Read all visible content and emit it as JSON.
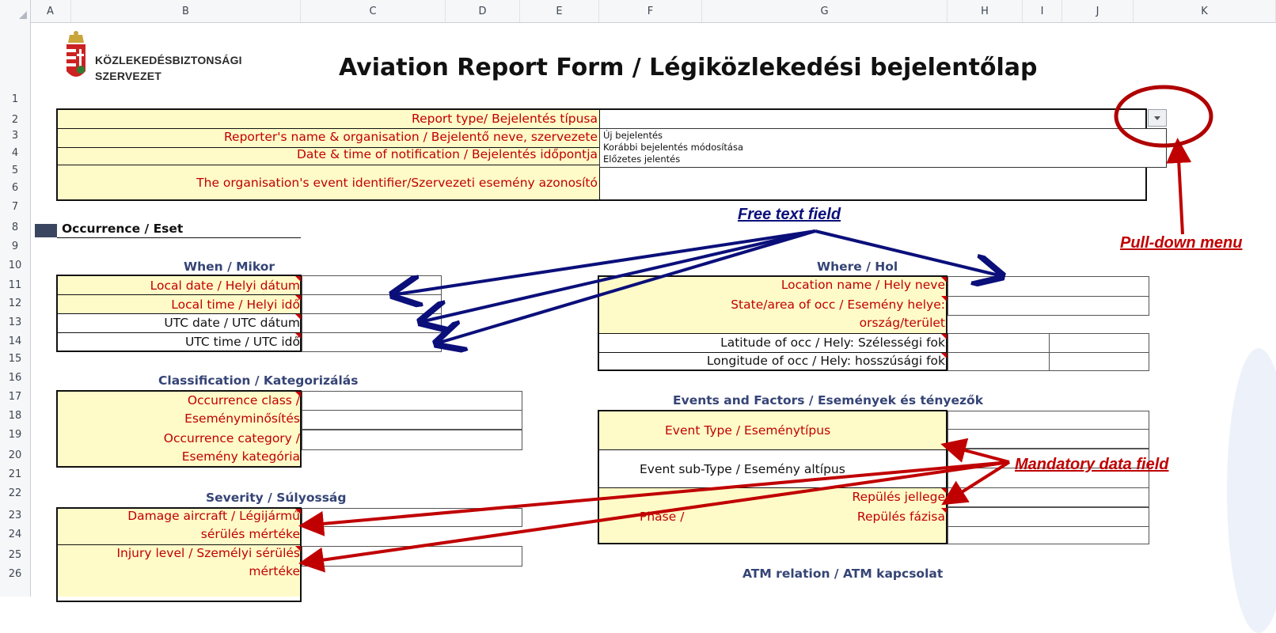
{
  "columns": [
    "A",
    "B",
    "C",
    "D",
    "E",
    "F",
    "G",
    "H",
    "I",
    "J",
    "K"
  ],
  "rows": [
    "1",
    "2",
    "3",
    "4",
    "5",
    "6",
    "7",
    "8",
    "9",
    "10",
    "11",
    "12",
    "13",
    "14",
    "15",
    "16",
    "17",
    "18",
    "19",
    "20",
    "21",
    "22",
    "23",
    "24",
    "25",
    "26"
  ],
  "logo": {
    "line1": "KÖZLEKEDÉSBIZTONSÁGI",
    "line2": "SZERVEZET"
  },
  "title": "Aviation Report Form / Légiközlekedési bejelentőlap",
  "header_form": {
    "report_type": "Report type/ Bejelentés típusa",
    "reporter": "Reporter's name & organisation / Bejelentő neve, szervezete",
    "date_time": "Date & time of notification / Bejelentés időpontja",
    "event_id": "The organisation's event identifier/Szervezeti esemény azonosító"
  },
  "dropdown": {
    "options": [
      "Új bejelentés",
      "Korábbi bejelentés módosítása",
      "Előzetes jelentés"
    ]
  },
  "occurrence": "Occurrence / Eset",
  "when": {
    "heading": "When / Mikor",
    "local_date": "Local date / Helyi dátum",
    "local_time": "Local time / Helyi idő",
    "utc_date": "UTC date / UTC dátum",
    "utc_time": "UTC time / UTC idő"
  },
  "where": {
    "heading": "Where / Hol",
    "location": "Location name / Hely neve",
    "state1": "State/area of occ / Esemény helye:",
    "state2": "ország/terület",
    "lat": "Latitude of occ / Hely: Szélességi fok",
    "lon": "Longitude of occ / Hely: hosszúsági fok"
  },
  "classification": {
    "heading": "Classification / Kategorizálás",
    "class1": "Occurrence class /",
    "class2": "Eseményminősítés",
    "cat1": "Occurrence category /",
    "cat2": "Esemény kategória"
  },
  "events": {
    "heading": "Events and Factors / Események és tényezők",
    "type": "Event Type / Eseménytípus",
    "subtype": "Event sub-Type / Esemény altípus",
    "flight_nature": "Repülés jellege",
    "phase_prefix": "Phase /",
    "phase": "Repülés fázisa"
  },
  "severity": {
    "heading": "Severity / Súlyosság",
    "damage1": "Damage aircraft / Légijármű",
    "damage2": "sérülés mértéke",
    "injury1": "Injury level / Személyi sérülés",
    "injury2": "mértéke"
  },
  "atm": {
    "heading": "ATM relation / ATM kapcsolat"
  },
  "annotations": {
    "free_text": "Free text field",
    "pulldown": "Pull-down menu",
    "mandatory": "Mandatory data field"
  },
  "colors": {
    "navy": "#0b0f7a",
    "red": "#c00000",
    "form_yellow": "#fffbc8",
    "label_red": "#c00000",
    "section_blue": "#354476"
  }
}
